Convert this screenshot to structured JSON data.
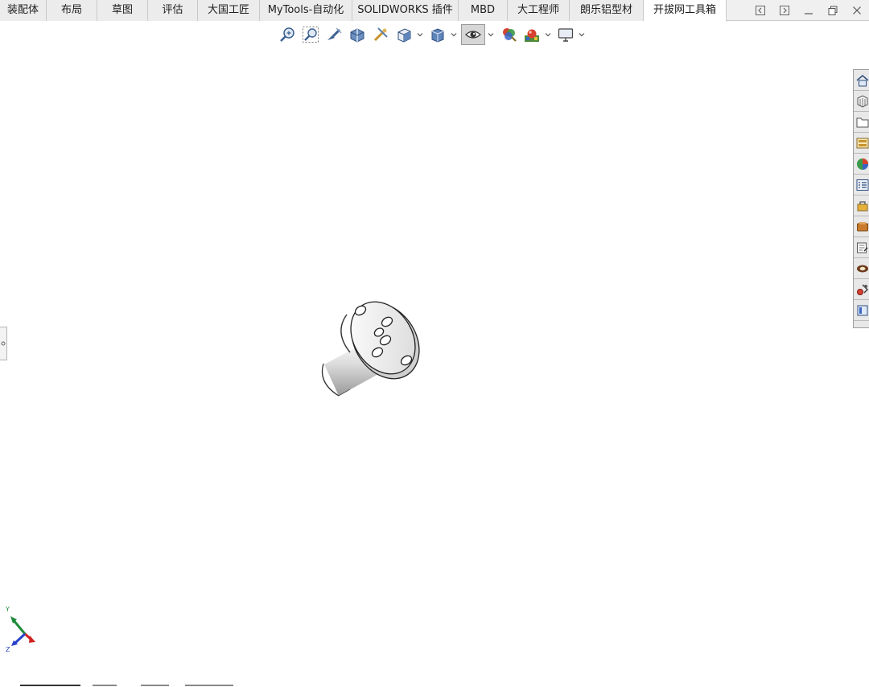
{
  "tabs": [
    {
      "label": "装配体",
      "active": false
    },
    {
      "label": "布局",
      "active": false
    },
    {
      "label": "草图",
      "active": false
    },
    {
      "label": "评估",
      "active": false
    },
    {
      "label": "大国工匠",
      "active": false
    },
    {
      "label": "MyTools-自动化",
      "active": false
    },
    {
      "label": "SOLIDWORKS 插件",
      "active": false
    },
    {
      "label": "MBD",
      "active": false
    },
    {
      "label": "大工程师",
      "active": false
    },
    {
      "label": "朗乐铝型材",
      "active": false
    },
    {
      "label": "开拔网工具箱",
      "active": true
    }
  ],
  "window_controls": [
    "panel-left-icon",
    "panel-right-icon",
    "minimize-icon",
    "restore-icon",
    "close-icon"
  ],
  "view_toolbar": {
    "buttons": [
      "zoom-to-fit-icon",
      "zoom-to-area-icon",
      "previous-view-icon",
      "section-view-icon",
      "dynamic-annotation-icon",
      "view-orientation-icon",
      "display-style-icon",
      "hide-show-items-icon",
      "edit-appearance-icon",
      "apply-scene-icon",
      "view-settings-icon"
    ],
    "pressed": "hide-show-items-icon"
  },
  "task_pane": {
    "buttons": [
      "home-icon",
      "design-library-icon",
      "file-explorer-icon",
      "view-palette-icon",
      "appearances-icon",
      "custom-properties-icon",
      "toolbox-icon",
      "forum-icon",
      "document-recovery-icon",
      "solidworks-resources-icon",
      "plugin-icon",
      "extra-icon"
    ]
  },
  "triad": {
    "axis_y": "Y",
    "axis_z": "Z"
  },
  "colors": {
    "tab_bg": "#ececec",
    "active_tab_bg": "#ffffff",
    "panel_bg": "#e8e8e8",
    "canvas_bg": "#ffffff",
    "triad_y": "#1f8a3a",
    "triad_z": "#2a44c8",
    "triad_x": "#d02020"
  }
}
